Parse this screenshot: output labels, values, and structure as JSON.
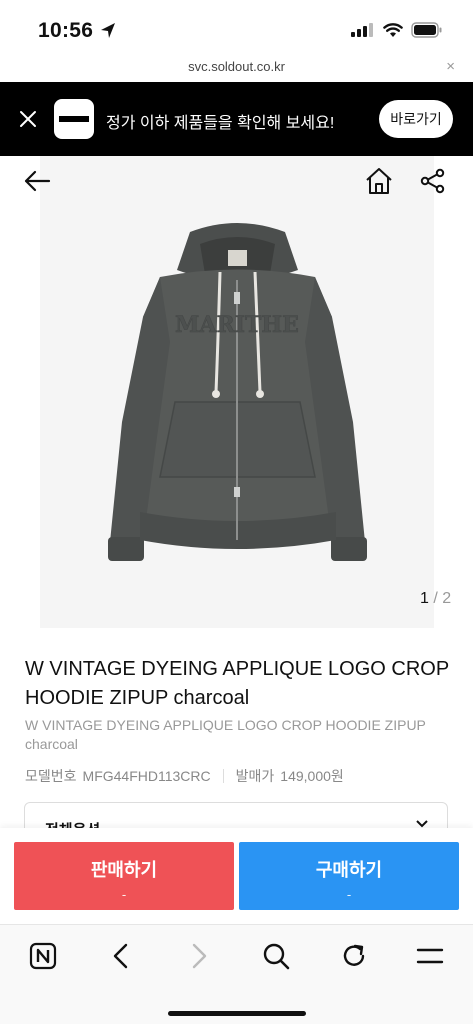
{
  "status": {
    "time": "10:56"
  },
  "url_bar": {
    "url": "svc.soldout.co.kr",
    "close": "×"
  },
  "promo": {
    "text": "정가 이하 제품들을 확인해 보세요!",
    "button": "바로가기"
  },
  "gallery": {
    "current": "1",
    "separator": "/",
    "total": "2",
    "garment_print": "MARITHE"
  },
  "product": {
    "title": "W VINTAGE DYEING APPLIQUE LOGO CROP HOODIE ZIPUP charcoal",
    "subtitle": "W VINTAGE DYEING APPLIQUE LOGO CROP HOODIE ZIPUP charcoal",
    "model_label": "모델번호",
    "model_value": "MFG44FHD113CRC",
    "price_label": "발매가",
    "price_value": "149,000원"
  },
  "option": {
    "label": "전체옵션"
  },
  "cta": {
    "sell_label": "판매하기",
    "sell_price": "-",
    "buy_label": "구매하기",
    "buy_price": "-"
  },
  "colors": {
    "sell": "#ef5256",
    "buy": "#2a94f3",
    "promo_bg": "#000000"
  },
  "icons": [
    "location-arrow-icon",
    "signal-icon",
    "wifi-icon",
    "battery-icon",
    "close-icon",
    "back-arrow-icon",
    "home-icon",
    "share-icon",
    "chevron-down-icon",
    "naver-icon",
    "browser-back-icon",
    "browser-forward-icon",
    "search-icon",
    "refresh-icon",
    "menu-icon"
  ]
}
